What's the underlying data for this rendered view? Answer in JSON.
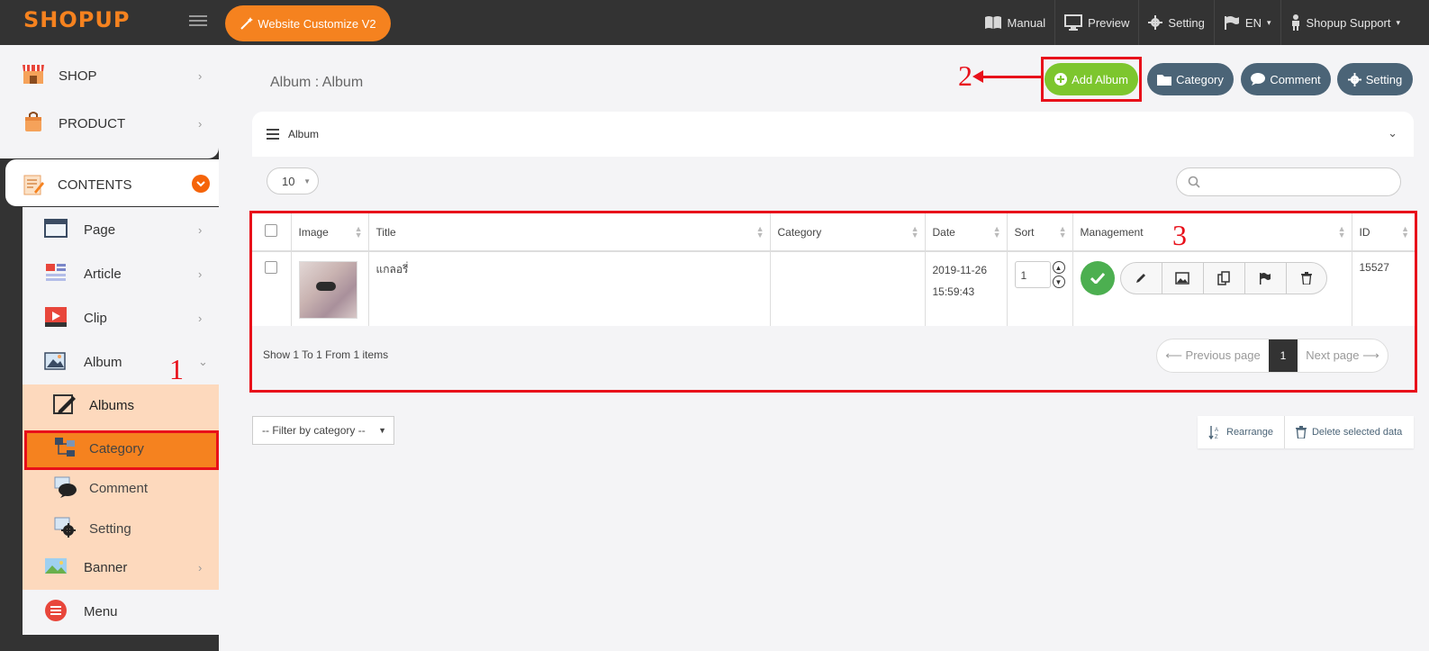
{
  "topbar": {
    "logo": "SHOPUP",
    "customize_label": "Website Customize V2",
    "nav": {
      "manual": "Manual",
      "preview": "Preview",
      "setting": "Setting",
      "language": "EN",
      "support": "Shopup Support"
    }
  },
  "sidebar": {
    "shop": "SHOP",
    "product": "PRODUCT",
    "contents": "CONTENTS",
    "page": "Page",
    "article": "Article",
    "clip": "Clip",
    "album": "Album",
    "albums": "Albums",
    "category": "Category",
    "comment": "Comment",
    "setting": "Setting",
    "banner": "Banner",
    "menu": "Menu"
  },
  "annotations": {
    "one": "1",
    "two": "2",
    "three": "3"
  },
  "header": {
    "title": "Album : Album",
    "add_album": "Add Album",
    "category": "Category",
    "comment": "Comment",
    "setting": "Setting"
  },
  "card": {
    "title": "Album",
    "page_size": "10",
    "search_placeholder": ""
  },
  "table": {
    "columns": [
      "Image",
      "Title",
      "Category",
      "Date",
      "Sort",
      "Management",
      "ID"
    ],
    "rows": [
      {
        "title": "แกลอรี่",
        "category": "",
        "date": "2019-11-26",
        "time": "15:59:43",
        "sort": "1",
        "id": "15527"
      }
    ],
    "footer_info": "Show 1 To 1 From 1 items",
    "pager": {
      "prev": "⟵ Previous page",
      "current": "1",
      "next": "Next page ⟶"
    }
  },
  "bottom": {
    "filter": "-- Filter by category --",
    "rearrange": "Rearrange",
    "delete_selected": "Delete selected data"
  },
  "colors": {
    "brand": "#f5821f",
    "dark": "#333333",
    "green": "#7dc62e",
    "slate": "#4b6477",
    "highlight": "#e8101a"
  }
}
